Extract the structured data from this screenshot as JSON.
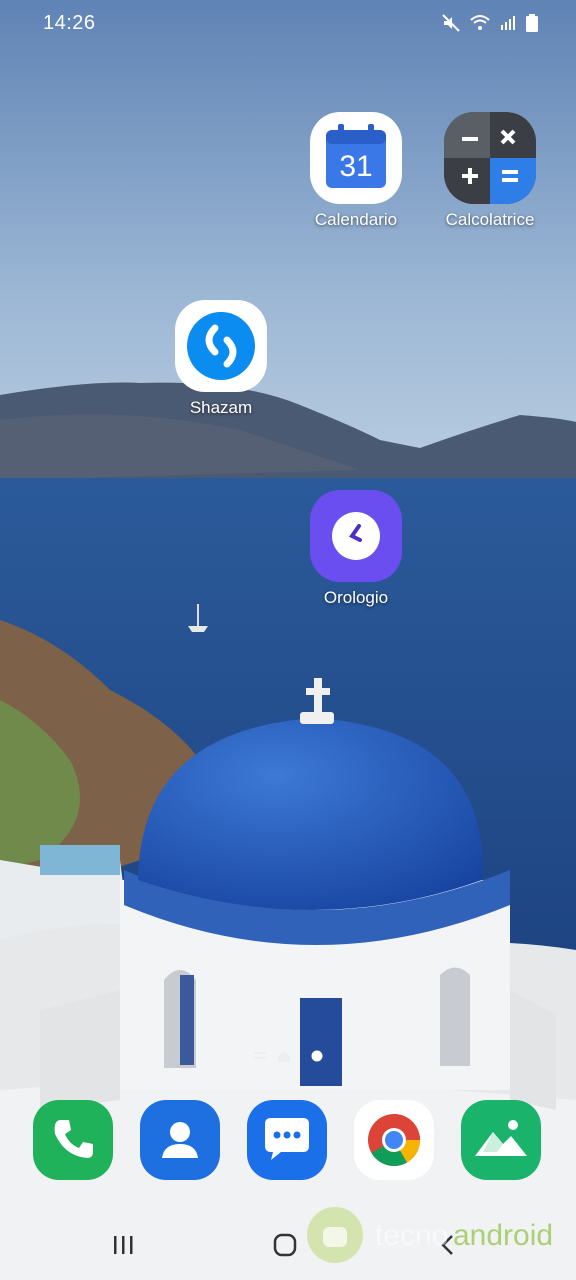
{
  "status_bar": {
    "time": "14:26",
    "icons": [
      "mute-icon",
      "wifi-icon",
      "signal-icon",
      "battery-icon"
    ]
  },
  "apps": [
    {
      "name": "calendar",
      "label": "Calendario",
      "icon": "calendar-icon",
      "day": "31",
      "color": "#3b78e7"
    },
    {
      "name": "calculator",
      "label": "Calcolatrice",
      "icon": "calculator-icon",
      "color": "#5a5f66"
    },
    {
      "name": "shazam",
      "label": "Shazam",
      "icon": "shazam-icon",
      "color": "#0a8cf0"
    },
    {
      "name": "clock",
      "label": "Orologio",
      "icon": "clock-icon",
      "color": "#6a4ef0"
    }
  ],
  "dock": [
    {
      "name": "phone",
      "icon": "phone-icon",
      "color": "#1fb25a"
    },
    {
      "name": "contacts",
      "icon": "contacts-icon",
      "color": "#1e6fe0"
    },
    {
      "name": "messages",
      "icon": "messages-icon",
      "color": "#1b6fe8"
    },
    {
      "name": "chrome",
      "icon": "chrome-icon",
      "color": "#ffffff"
    },
    {
      "name": "gallery",
      "icon": "gallery-icon",
      "color": "#19b36b"
    }
  ],
  "page_indicator": {
    "pages": 3,
    "current": 3
  },
  "navigation": [
    "recents-button",
    "home-button",
    "back-button"
  ],
  "watermark": {
    "part1": "tecno",
    "part2": "android"
  }
}
